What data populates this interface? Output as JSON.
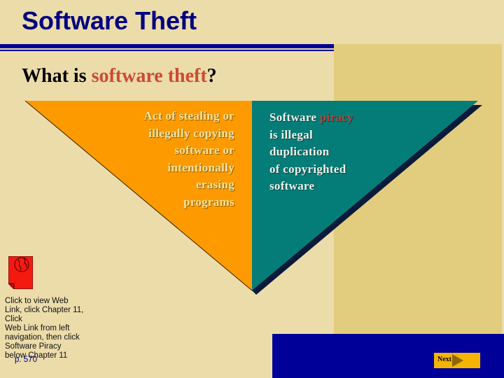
{
  "slide": {
    "title": "Software Theft",
    "subtitle_prefix": "What is ",
    "subtitle_highlight": "software theft",
    "subtitle_suffix": "?"
  },
  "left_panel": {
    "lines": [
      "Act of stealing or",
      "illegally copying",
      "software or",
      "intentionally",
      "erasing",
      "programs"
    ]
  },
  "right_panel": {
    "line1_prefix": "Software ",
    "line1_highlight": "piracy",
    "lines": [
      "is illegal",
      "duplication",
      "of copyrighted",
      "software"
    ]
  },
  "web_link": {
    "icon": "web-link-globe-icon",
    "text_lines": [
      "Click to view Web",
      "Link, click Chapter 11,",
      "Click",
      "Web Link from left",
      "navigation, then click",
      "Software Piracy",
      "below Chapter 11"
    ],
    "page_ref": "p. 570"
  },
  "navigation": {
    "next_label": "Next",
    "next_icon": "play-arrow-icon"
  },
  "colors": {
    "background": "#ecdcaa",
    "title": "#000080",
    "highlight": "#cc4a33",
    "orange": "#fd9a00",
    "teal": "#047d79",
    "navy_bar": "#000099",
    "panel": "#e2cd7e"
  }
}
